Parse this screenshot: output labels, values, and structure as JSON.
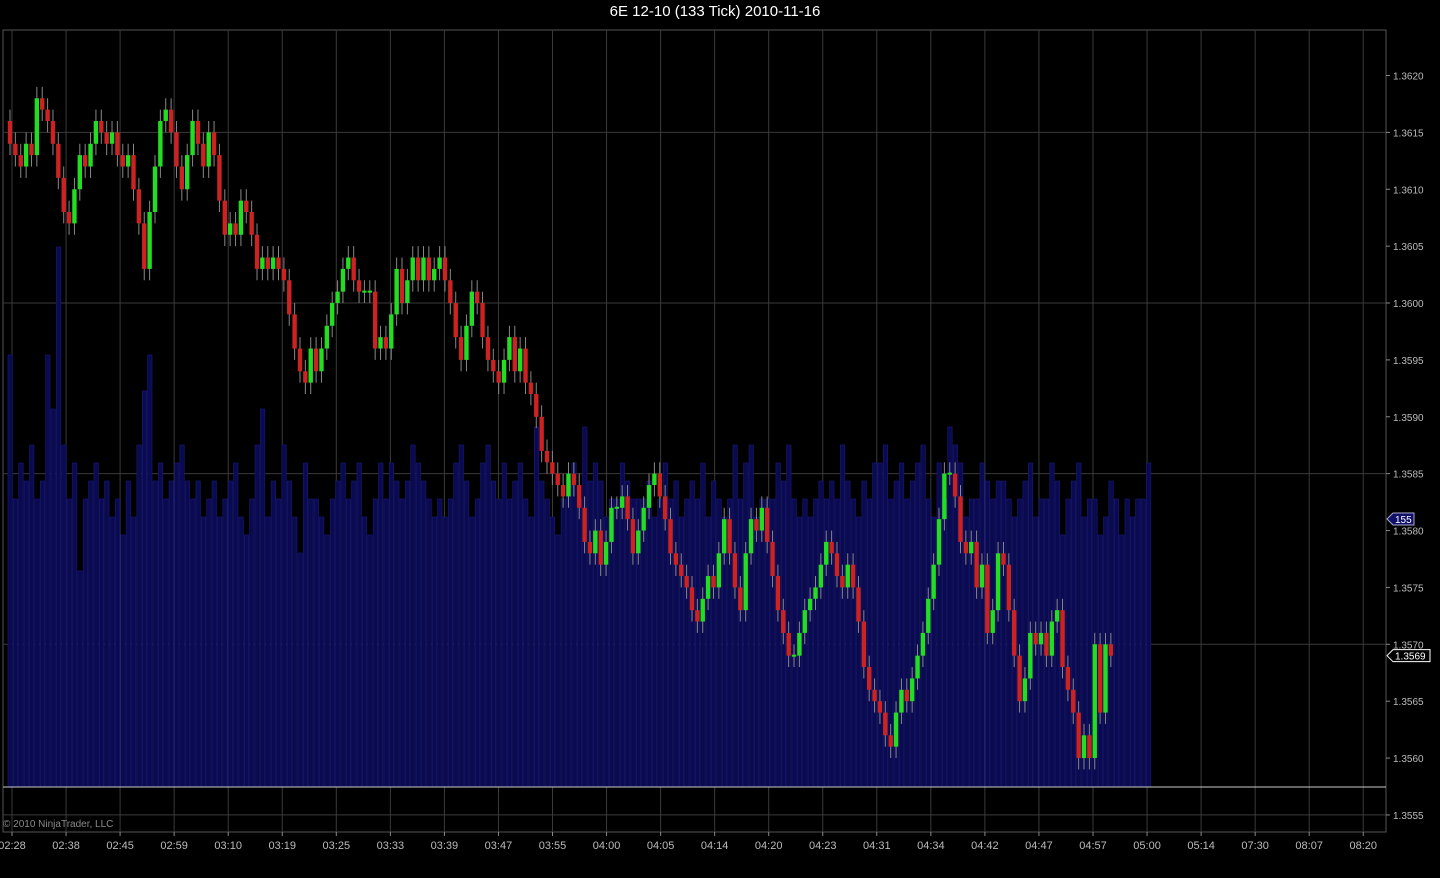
{
  "window": {
    "title": "6E 12-10 (133 Tick)  2010-11-16"
  },
  "copyright": "© 2010 NinjaTrader, LLC",
  "colors": {
    "background": "#000000",
    "grid": "#3a3a3a",
    "up_candle": "#22dd22",
    "down_candle": "#cc2222",
    "volume": "#0a0a50",
    "volume_outline": "#1a1a7a",
    "price_marker": "#000000",
    "volume_marker": "#10106a"
  },
  "chart_data": {
    "type": "candlestick",
    "instrument": "6E 12-10",
    "bar_type": "133 Tick",
    "date": "2010-11-16",
    "ylim": [
      1.35535,
      1.3624
    ],
    "y_ticks": [
      "1.3620",
      "1.3615",
      "1.3610",
      "1.3605",
      "1.3600",
      "1.3595",
      "1.3590",
      "1.3585",
      "1.3580",
      "1.3575",
      "1.3570",
      "1.3565",
      "1.3560",
      "1.3555"
    ],
    "x_tick_labels": [
      "02:28",
      "02:38",
      "02:45",
      "02:59",
      "03:10",
      "03:19",
      "03:25",
      "03:33",
      "03:39",
      "03:47",
      "03:55",
      "04:00",
      "04:05",
      "04:14",
      "04:20",
      "04:23",
      "04:31",
      "04:34",
      "04:42",
      "04:47",
      "04:57",
      "05:00",
      "05:14",
      "07:30",
      "08:07",
      "08:20"
    ],
    "last_price": "1.3569",
    "last_volume": "155",
    "closes": [
      1.3614,
      1.3613,
      1.3612,
      1.3614,
      1.3613,
      1.3618,
      1.3617,
      1.3616,
      1.3614,
      1.3611,
      1.3608,
      1.3607,
      1.361,
      1.3613,
      1.3612,
      1.3614,
      1.3616,
      1.3615,
      1.3614,
      1.3615,
      1.3613,
      1.3612,
      1.3613,
      1.361,
      1.3607,
      1.3603,
      1.3608,
      1.3612,
      1.3616,
      1.3617,
      1.3615,
      1.3612,
      1.361,
      1.3613,
      1.3616,
      1.3614,
      1.3612,
      1.3615,
      1.3613,
      1.3609,
      1.3606,
      1.3607,
      1.3606,
      1.3609,
      1.3608,
      1.3606,
      1.3603,
      1.3604,
      1.3603,
      1.3604,
      1.3603,
      1.3602,
      1.3599,
      1.3596,
      1.3594,
      1.3593,
      1.3596,
      1.3594,
      1.3596,
      1.3598,
      1.36,
      1.3601,
      1.3603,
      1.3604,
      1.3602,
      1.3601,
      1.3601,
      1.3601,
      1.3596,
      1.3597,
      1.3596,
      1.3599,
      1.3603,
      1.36,
      1.3602,
      1.3604,
      1.3602,
      1.3604,
      1.3602,
      1.3603,
      1.3604,
      1.3602,
      1.36,
      1.3597,
      1.3595,
      1.3598,
      1.3601,
      1.36,
      1.3597,
      1.3595,
      1.3594,
      1.3593,
      1.3595,
      1.3597,
      1.3594,
      1.3596,
      1.3593,
      1.3592,
      1.359,
      1.3587,
      1.3586,
      1.3585,
      1.3584,
      1.3583,
      1.3585,
      1.3584,
      1.3582,
      1.3579,
      1.3578,
      1.358,
      1.3577,
      1.3579,
      1.3582,
      1.3582,
      1.3583,
      1.3581,
      1.3578,
      1.358,
      1.3582,
      1.3584,
      1.3585,
      1.3583,
      1.3581,
      1.3578,
      1.3577,
      1.3576,
      1.3575,
      1.3573,
      1.3572,
      1.3574,
      1.3576,
      1.3575,
      1.3578,
      1.3581,
      1.3578,
      1.3575,
      1.3573,
      1.3578,
      1.3581,
      1.358,
      1.3582,
      1.3579,
      1.3576,
      1.3573,
      1.3571,
      1.3569,
      1.3569,
      1.3571,
      1.3573,
      1.3574,
      1.3575,
      1.3577,
      1.3579,
      1.3578,
      1.3576,
      1.3575,
      1.3577,
      1.3575,
      1.3572,
      1.3568,
      1.3566,
      1.3565,
      1.3564,
      1.3562,
      1.3561,
      1.3564,
      1.3566,
      1.3565,
      1.3567,
      1.3569,
      1.3571,
      1.3574,
      1.3577,
      1.3581,
      1.3585,
      1.3585,
      1.3583,
      1.3579,
      1.3578,
      1.3579,
      1.3575,
      1.3577,
      1.3571,
      1.3573,
      1.3578,
      1.3577,
      1.3573,
      1.3569,
      1.3565,
      1.3567,
      1.3571,
      1.357,
      1.3571,
      1.3569,
      1.3572,
      1.3573,
      1.3568,
      1.3566,
      1.3564,
      1.356,
      1.3562,
      1.356,
      1.357,
      1.3564,
      1.357,
      1.3569
    ],
    "volumes": [
      120,
      80,
      90,
      85,
      95,
      80,
      85,
      120,
      105,
      150,
      95,
      80,
      90,
      60,
      80,
      85,
      90,
      80,
      85,
      75,
      80,
      70,
      85,
      75,
      95,
      110,
      120,
      85,
      90,
      80,
      85,
      90,
      95,
      85,
      80,
      85,
      75,
      80,
      85,
      75,
      80,
      85,
      90,
      75,
      70,
      80,
      95,
      105,
      75,
      85,
      80,
      95,
      85,
      75,
      65,
      90,
      80,
      80,
      75,
      70,
      80,
      85,
      90,
      80,
      85,
      90,
      75,
      70,
      80,
      90,
      80,
      90,
      85,
      80,
      85,
      95,
      90,
      85,
      80,
      75,
      80,
      75,
      80,
      90,
      95,
      85,
      75,
      80,
      90,
      95,
      85,
      80,
      90,
      80,
      85,
      90,
      80,
      75,
      100,
      85,
      80,
      75,
      70,
      80,
      85,
      90,
      80,
      100,
      85,
      90,
      85,
      75,
      80,
      80,
      90,
      85,
      80,
      80,
      80,
      85,
      75,
      80,
      90,
      80,
      85,
      75,
      80,
      85,
      80,
      90,
      75,
      85,
      80,
      75,
      80,
      95,
      80,
      90,
      95,
      75,
      80,
      80,
      80,
      90,
      85,
      95,
      80,
      75,
      80,
      75,
      80,
      85,
      80,
      85,
      80,
      95,
      85,
      80,
      75,
      85,
      80,
      90,
      90,
      95,
      80,
      85,
      90,
      80,
      85,
      90,
      95,
      80,
      75,
      90,
      80,
      100,
      95,
      90,
      75,
      80,
      80,
      90,
      85,
      80,
      85,
      85,
      80,
      75,
      80,
      85,
      90,
      75,
      80,
      80,
      90,
      85,
      70,
      80,
      85,
      90,
      75,
      80,
      80,
      70,
      75,
      85,
      80,
      70,
      80,
      75,
      80,
      80,
      90
    ]
  }
}
